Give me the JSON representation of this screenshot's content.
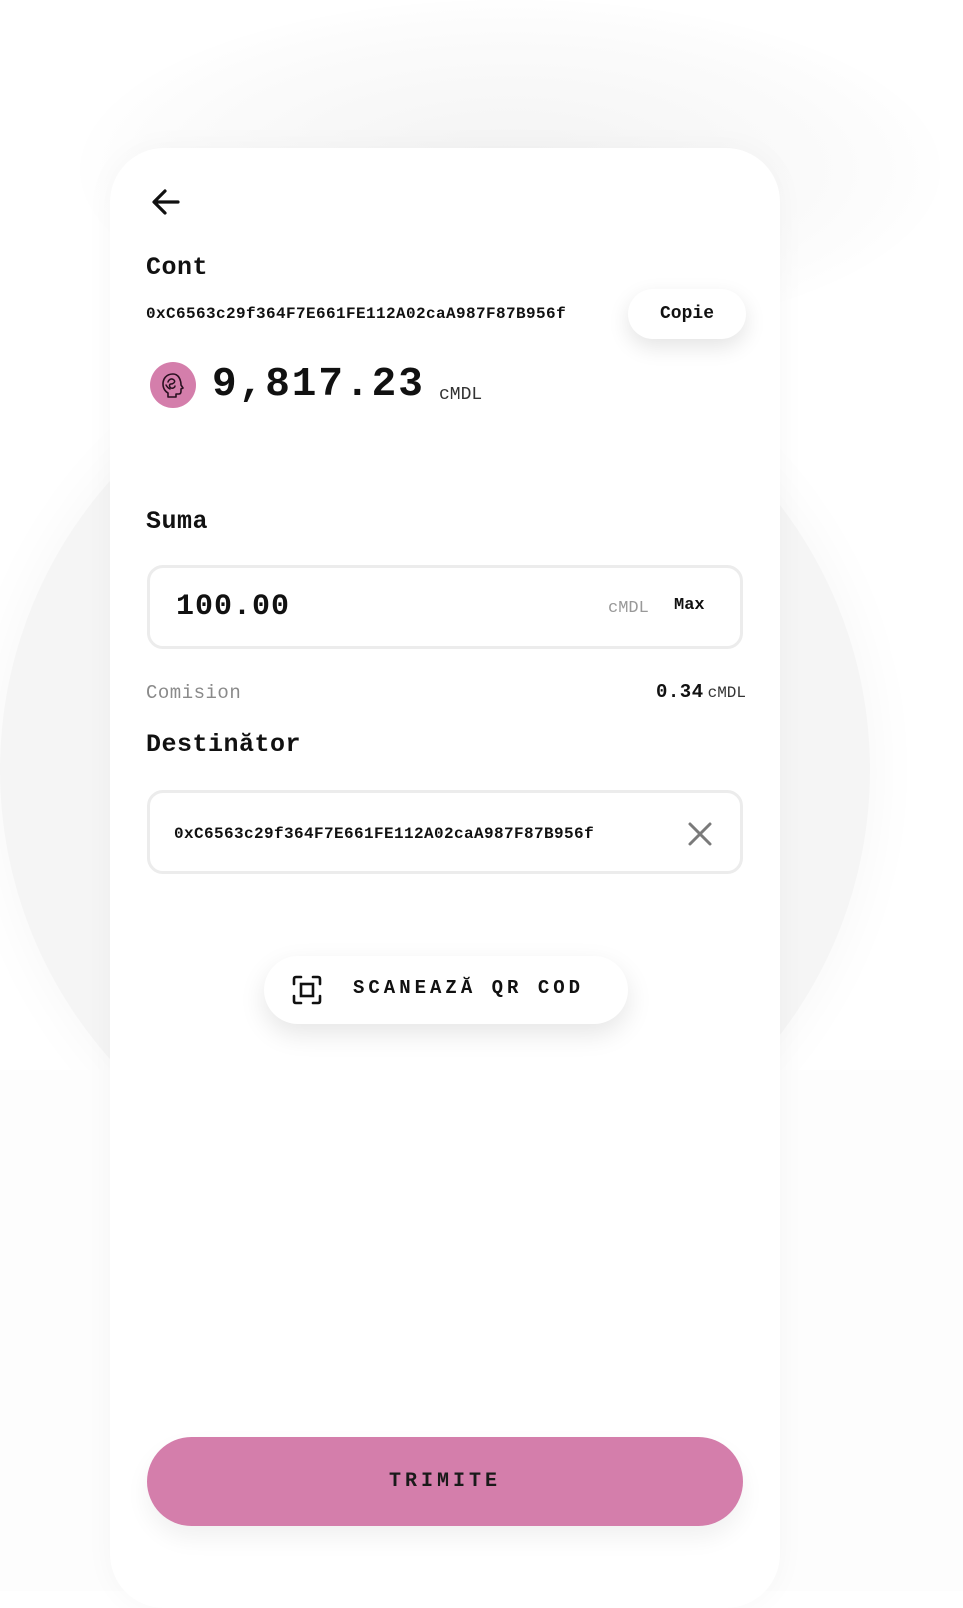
{
  "account": {
    "title": "Cont",
    "address": "0xC6563c29f364F7E661FE112A02caA987F87B956f",
    "copy_label": "Copie",
    "balance": "9,817.23",
    "currency": "cMDL"
  },
  "amount": {
    "title": "Suma",
    "value": "100.00",
    "currency": "cMDL",
    "max_label": "Max"
  },
  "fee": {
    "label": "Comision",
    "value": "0.34",
    "currency": "cMDL"
  },
  "recipient": {
    "title": "Destinător",
    "address": "0xC6563c29f364F7E661FE112A02caA987F87B956f"
  },
  "scan": {
    "label": "SCANEAZĂ QR COD"
  },
  "send": {
    "label": "TRIMITE"
  },
  "icons": {
    "back": "arrow-left-icon",
    "token": "token-logo-icon",
    "clear": "close-icon",
    "scan": "qr-scan-icon"
  },
  "colors": {
    "accent": "#d47eab",
    "input_border": "#ececec",
    "muted_text": "#8a8a8a"
  }
}
